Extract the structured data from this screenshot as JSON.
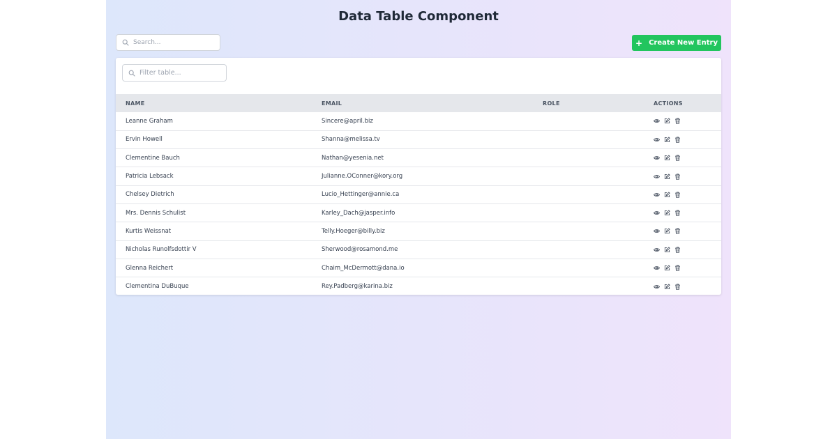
{
  "title": "Data Table Component",
  "search": {
    "placeholder": "Search...",
    "value": ""
  },
  "create_button": {
    "label": "Create New Entry",
    "icon": "plus-icon"
  },
  "filter": {
    "placeholder": "Filter table...",
    "value": ""
  },
  "columns": [
    "NAME",
    "EMAIL",
    "ROLE",
    "ACTIONS"
  ],
  "rows": [
    {
      "name": "Leanne Graham",
      "email": "Sincere@april.biz",
      "role": ""
    },
    {
      "name": "Ervin Howell",
      "email": "Shanna@melissa.tv",
      "role": ""
    },
    {
      "name": "Clementine Bauch",
      "email": "Nathan@yesenia.net",
      "role": ""
    },
    {
      "name": "Patricia Lebsack",
      "email": "Julianne.OConner@kory.org",
      "role": ""
    },
    {
      "name": "Chelsey Dietrich",
      "email": "Lucio_Hettinger@annie.ca",
      "role": ""
    },
    {
      "name": "Mrs. Dennis Schulist",
      "email": "Karley_Dach@jasper.info",
      "role": ""
    },
    {
      "name": "Kurtis Weissnat",
      "email": "Telly.Hoeger@billy.biz",
      "role": ""
    },
    {
      "name": "Nicholas Runolfsdottir V",
      "email": "Sherwood@rosamond.me",
      "role": ""
    },
    {
      "name": "Glenna Reichert",
      "email": "Chaim_McDermott@dana.io",
      "role": ""
    },
    {
      "name": "Clementina DuBuque",
      "email": "Rey.Padberg@karina.biz",
      "role": ""
    }
  ],
  "row_actions": [
    "view-icon",
    "edit-icon",
    "delete-icon"
  ],
  "colors": {
    "accent": "#22c55e",
    "header_bg": "#e5e7eb",
    "gradient_start": "#dde7fb",
    "gradient_end": "#efe3fb"
  }
}
